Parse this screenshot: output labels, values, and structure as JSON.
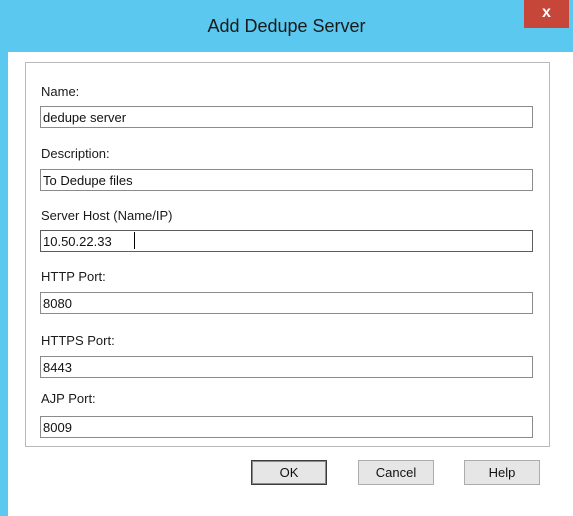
{
  "dialog": {
    "title": "Add Dedupe Server",
    "close_glyph": "x"
  },
  "fields": {
    "name": {
      "label": "Name:",
      "value": "dedupe server"
    },
    "description": {
      "label": "Description:",
      "value": "To Dedupe files"
    },
    "server_host": {
      "label": "Server Host (Name/IP)",
      "value": "10.50.22.33"
    },
    "http_port": {
      "label": "HTTP Port:",
      "value": "8080"
    },
    "https_port": {
      "label": "HTTPS Port:",
      "value": "8443"
    },
    "ajp_port": {
      "label": "AJP Port:",
      "value": "8009"
    }
  },
  "buttons": {
    "ok": "OK",
    "cancel": "Cancel",
    "help": "Help"
  },
  "colors": {
    "title_bar": "#5ac8ef",
    "close_button": "#c7463a"
  },
  "icons": {
    "close": "close-icon"
  }
}
